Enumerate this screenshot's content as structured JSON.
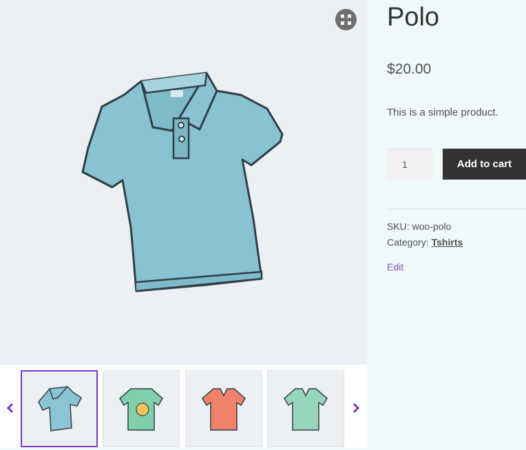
{
  "product": {
    "title": "Polo",
    "price": "$20.00",
    "description": "This is a simple product.",
    "quantity": "1",
    "add_to_cart_label": "Add to cart",
    "sku_label": "SKU:",
    "sku_value": "woo-polo",
    "category_label": "Category:",
    "category_value": "Tshirts",
    "edit_label": "Edit"
  },
  "gallery": {
    "thumbnails": [
      {
        "name": "Polo",
        "color": "#8cc4d6",
        "active": true
      },
      {
        "name": "Happy Ninja tee",
        "color": "#7fcfab",
        "active": false
      },
      {
        "name": "V-neck orange",
        "color": "#f0826a",
        "active": false
      },
      {
        "name": "V-neck green",
        "color": "#97d6bb",
        "active": false
      }
    ],
    "icons": {
      "zoom": "expand-icon",
      "prev": "chevron-left-icon",
      "next": "chevron-right-icon"
    },
    "accent": "#7f36c8"
  }
}
